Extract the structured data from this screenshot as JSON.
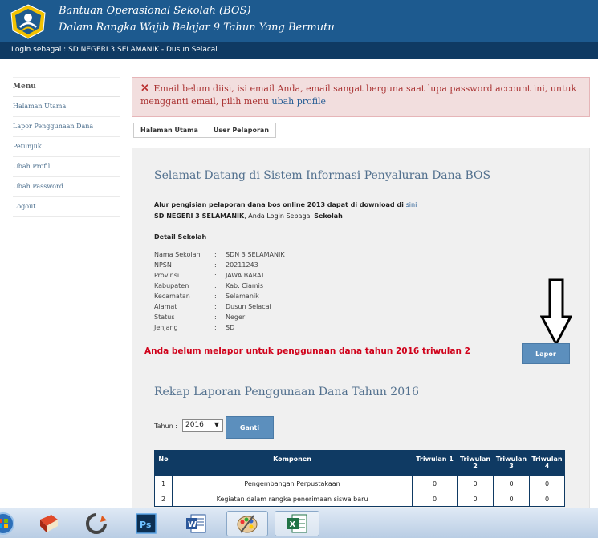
{
  "header": {
    "title_line1": "Bantuan Operasional Sekolah (BOS)",
    "title_line2": "Dalam Rangka Wajib Belajar 9 Tahun Yang Bermutu"
  },
  "login": {
    "label": "Login sebagai : SD NEGERI 3 SELAMANIK - Dusun Selacai"
  },
  "sidebar": {
    "heading": "Menu",
    "items": [
      {
        "label": "Halaman Utama"
      },
      {
        "label": "Lapor Penggunaan Dana"
      },
      {
        "label": "Petunjuk"
      },
      {
        "label": "Ubah Profil"
      },
      {
        "label": "Ubah Password"
      },
      {
        "label": "Logout"
      }
    ]
  },
  "alert": {
    "text": "Email belum diisi, isi email Anda, email sangat berguna saat lupa password account ini, untuk mengganti email, pilih menu",
    "link": "ubah profile"
  },
  "breadcrumb": [
    "Halaman Utama",
    "User Pelaporan"
  ],
  "main": {
    "welcome": "Selamat Datang di Sistem Informasi Penyaluran Dana BOS",
    "alur_text": "Alur pengisian pelaporan dana bos online 2013 dapat di download di",
    "alur_link": "sini",
    "school_name": "SD NEGERI 3 SELAMANIK",
    "login_as_text": ", Anda Login Sebagai",
    "login_as_role": "Sekolah",
    "detail_title": "Detail Sekolah",
    "details": [
      {
        "key": "Nama Sekolah",
        "value": "SDN 3 SELAMANIK"
      },
      {
        "key": "NPSN",
        "value": "20211243"
      },
      {
        "key": "Provinsi",
        "value": "JAWA BARAT"
      },
      {
        "key": "Kabupaten",
        "value": "Kab. Ciamis"
      },
      {
        "key": "Kecamatan",
        "value": "Selamanik"
      },
      {
        "key": "Alamat",
        "value": "Dusun Selacai"
      },
      {
        "key": "Status",
        "value": "Negeri"
      },
      {
        "key": "Jenjang",
        "value": "SD"
      }
    ],
    "warning": "Anda belum melapor untuk penggunaan dana tahun 2016 triwulan 2",
    "lapor_button": "Lapor",
    "rekap_title": "Rekap Laporan Penggunaan Dana Tahun 2016",
    "tahun_label": "Tahun :",
    "tahun_value": "2016",
    "ganti_button": "Ganti"
  },
  "table": {
    "headers": [
      "No",
      "Komponen",
      "Triwulan 1",
      "Triwulan 2",
      "Triwulan 3",
      "Triwulan 4"
    ],
    "rows": [
      [
        "1",
        "Pengembangan Perpustakaan",
        "0",
        "0",
        "0",
        "0"
      ],
      [
        "2",
        "Kegiatan dalam rangka penerimaan siswa baru",
        "0",
        "0",
        "0",
        "0"
      ]
    ]
  },
  "taskbar": {
    "icons": [
      "windows-orb-icon",
      "book-icon",
      "refresh-icon",
      "photoshop-icon",
      "word-icon",
      "paint-icon",
      "excel-icon"
    ]
  }
}
